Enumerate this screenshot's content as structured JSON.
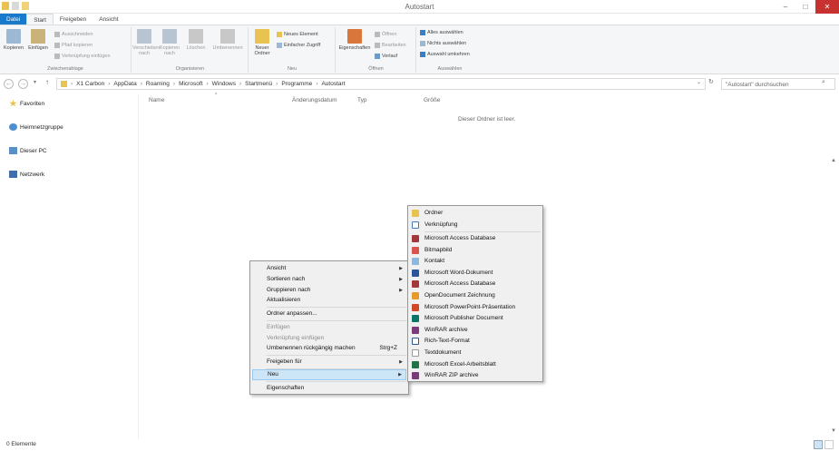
{
  "window": {
    "title": "Autostart",
    "controls": [
      "–",
      "□",
      "✕"
    ]
  },
  "tabs": [
    "Datei",
    "Start",
    "Freigeben",
    "Ansicht"
  ],
  "ribbon": {
    "clipboard": {
      "label": "Zwischenablage",
      "copy": "Kopieren",
      "paste": "Einfügen",
      "cut": "Ausschneiden",
      "copy_path": "Pfad kopieren",
      "paste_shortcut": "Verknüpfung einfügen"
    },
    "organize": {
      "label": "Organisieren",
      "move": "Verschieben nach",
      "copy_to": "Kopieren nach",
      "delete": "Löschen",
      "rename": "Umbenennen"
    },
    "new": {
      "label": "Neu",
      "new_folder": "Neuer Ordner",
      "new_item": "Neues Element",
      "easy_access": "Einfacher Zugriff"
    },
    "open": {
      "label": "Öffnen",
      "properties": "Eigenschaften",
      "open": "Öffnen",
      "edit": "Bearbeiten",
      "history": "Verlauf"
    },
    "select": {
      "label": "Auswählen",
      "all": "Alles auswählen",
      "none": "Nichts auswählen",
      "invert": "Auswahl umkehren"
    }
  },
  "address": {
    "path": [
      "X1 Carbon",
      "AppData",
      "Roaming",
      "Microsoft",
      "Windows",
      "Startmenü",
      "Programme",
      "Autostart"
    ],
    "search_placeholder": "\"Autostart\" durchsuchen"
  },
  "nav": [
    "Favoriten",
    "Heimnetzgruppe",
    "Dieser PC",
    "Netzwerk"
  ],
  "columns": [
    "Name",
    "Änderungsdatum",
    "Typ",
    "Größe"
  ],
  "empty_text": "Dieser Ordner ist leer.",
  "status": "0 Elemente",
  "context_menu": {
    "items": [
      "Ansicht",
      "Sortieren nach",
      "Gruppieren nach",
      "Aktualisieren",
      "Ordner anpassen...",
      "Einfügen",
      "Verknüpfung einfügen",
      "Umbenennen rückgängig machen",
      "Freigeben für",
      "Neu",
      "Eigenschaften"
    ],
    "undo_shortcut": "Strg+Z"
  },
  "new_submenu": [
    "Ordner",
    "Verknüpfung",
    "Microsoft Access Database",
    "Bitmapbild",
    "Kontakt",
    "Microsoft Word-Dokument",
    "Microsoft Access Database",
    "OpenDocument Zeichnung",
    "Microsoft PowerPoint-Präsentation",
    "Microsoft Publisher Document",
    "WinRAR archive",
    "Rich-Text-Format",
    "Textdokument",
    "Microsoft Excel-Arbeitsblatt",
    "WinRAR ZIP archive"
  ],
  "colors": {
    "accent": "#1979ca",
    "close": "#c7312f",
    "highlight": "#cde6f7"
  }
}
